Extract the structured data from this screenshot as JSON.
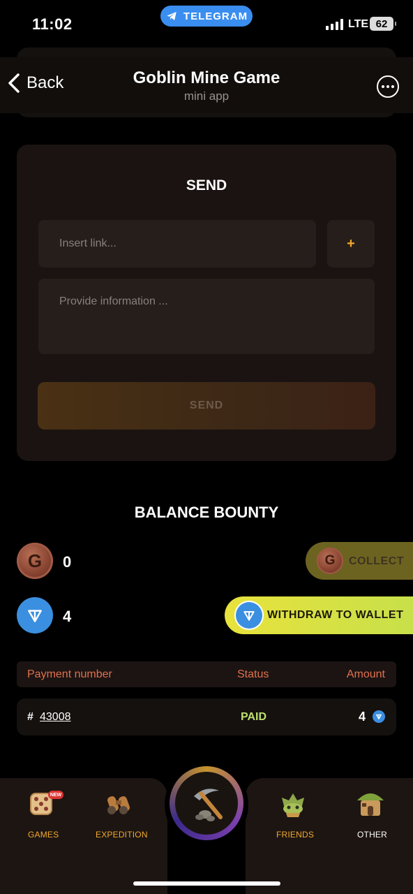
{
  "status_bar": {
    "time": "11:02",
    "pill_label": "TELEGRAM",
    "network": "LTE",
    "battery": "62"
  },
  "header": {
    "back_label": "Back",
    "title": "Goblin Mine Game",
    "subtitle": "mini app"
  },
  "send_card": {
    "title": "SEND",
    "link_placeholder": "Insert link...",
    "add_label": "+",
    "info_placeholder": "Provide information ...",
    "send_label": "SEND"
  },
  "balance": {
    "title": "BALANCE BOUNTY",
    "coin_letter": "G",
    "coin_value": "0",
    "collect_label": "COLLECT",
    "ton_value": "4",
    "withdraw_label": "WITHDRAW TO WALLET"
  },
  "table": {
    "headers": [
      "Payment number",
      "Status",
      "Amount"
    ],
    "rows": [
      {
        "hash": "#",
        "id": "43008",
        "status": "PAID",
        "amount": "4"
      }
    ]
  },
  "nav": {
    "items": [
      {
        "label": "GAMES",
        "icon": "dice-icon",
        "badge": "NEW"
      },
      {
        "label": "EXPEDITION",
        "icon": "binoculars-icon"
      },
      {
        "label": "",
        "icon": "pickaxe-icon"
      },
      {
        "label": "FRIENDS",
        "icon": "goblin-icon"
      },
      {
        "label": "OTHER",
        "icon": "hut-icon"
      }
    ]
  },
  "colors": {
    "accent_orange": "#f0a92d",
    "header_red": "#e0714f",
    "paid_green": "#bfe06e",
    "ton_blue": "#3b8fe0",
    "withdraw_yellow": "#e8e23c"
  }
}
